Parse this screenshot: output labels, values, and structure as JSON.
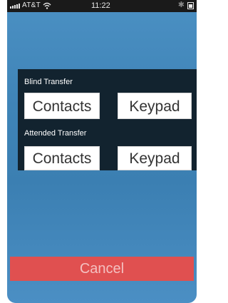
{
  "status_bar": {
    "carrier": "AT&T",
    "time": "11:22",
    "bluetooth_glyph": "✱"
  },
  "transfer": {
    "blind_label": "Blind Transfer",
    "blind_contacts": "Contacts",
    "blind_keypad": "Keypad",
    "attended_label": "Attended Transfer",
    "attended_contacts": "Contacts",
    "attended_keypad": "Keypad"
  },
  "cancel_label": "Cancel",
  "colors": {
    "background": "#3f84b7",
    "panel": "#12232f",
    "cancel": "#e05050"
  },
  "icons": [
    "signal-bars-icon",
    "wifi-icon",
    "bluetooth-icon",
    "battery-icon"
  ]
}
